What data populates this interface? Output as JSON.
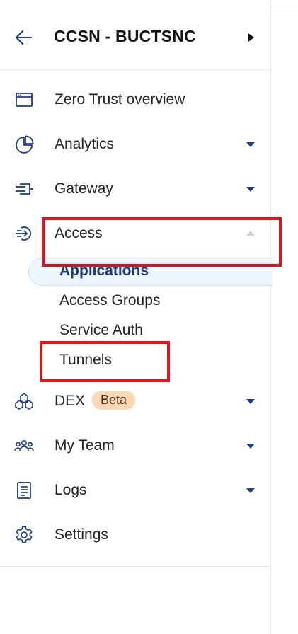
{
  "header": {
    "account_name": "CCSN - BUCTSNC"
  },
  "nav": {
    "zero_trust": {
      "label": "Zero Trust overview",
      "icon": "browser-window-icon"
    },
    "analytics": {
      "label": "Analytics",
      "icon": "pie-chart-icon"
    },
    "gateway": {
      "label": "Gateway",
      "icon": "gateway-icon"
    },
    "access": {
      "label": "Access",
      "icon": "access-arrow-icon",
      "children": [
        "Applications",
        "Access Groups",
        "Service Auth",
        "Tunnels"
      ]
    },
    "dex": {
      "label": "DEX",
      "badge": "Beta",
      "icon": "dex-network-icon"
    },
    "my_team": {
      "label": "My Team",
      "icon": "team-icon"
    },
    "logs": {
      "label": "Logs",
      "icon": "logs-icon"
    },
    "settings": {
      "label": "Settings",
      "icon": "gear-icon"
    }
  },
  "colors": {
    "icon_blue": "#1d3a8c",
    "active_bg": "#eef5ff",
    "badge_bg": "#fcd8b4",
    "annotation_red": "#e0141d"
  }
}
